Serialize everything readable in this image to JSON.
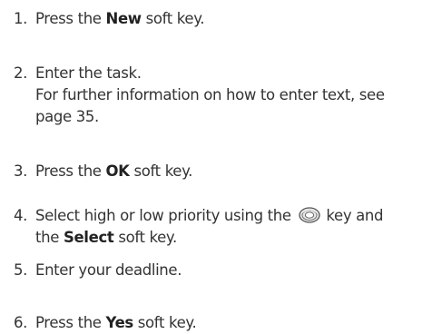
{
  "steps": [
    {
      "number": "1.",
      "pre": "Press the ",
      "key": "New",
      "post": " soft key."
    },
    {
      "number": "2.",
      "line1": "Enter the task.",
      "line2": "For further information on how to enter text, see",
      "line3": "page 35."
    },
    {
      "number": "3.",
      "pre": "Press the ",
      "key": "OK",
      "post": " soft key."
    },
    {
      "number": "4.",
      "pre": "Select high or low priority using the ",
      "icon": "navigation-key-icon",
      "mid": " key and",
      "line2_pre": "the ",
      "key": "Select",
      "post": " soft key."
    },
    {
      "number": "5.",
      "line1": "Enter your deadline."
    },
    {
      "number": "6.",
      "pre": "Press the ",
      "key": "Yes",
      "post": " soft key."
    }
  ]
}
